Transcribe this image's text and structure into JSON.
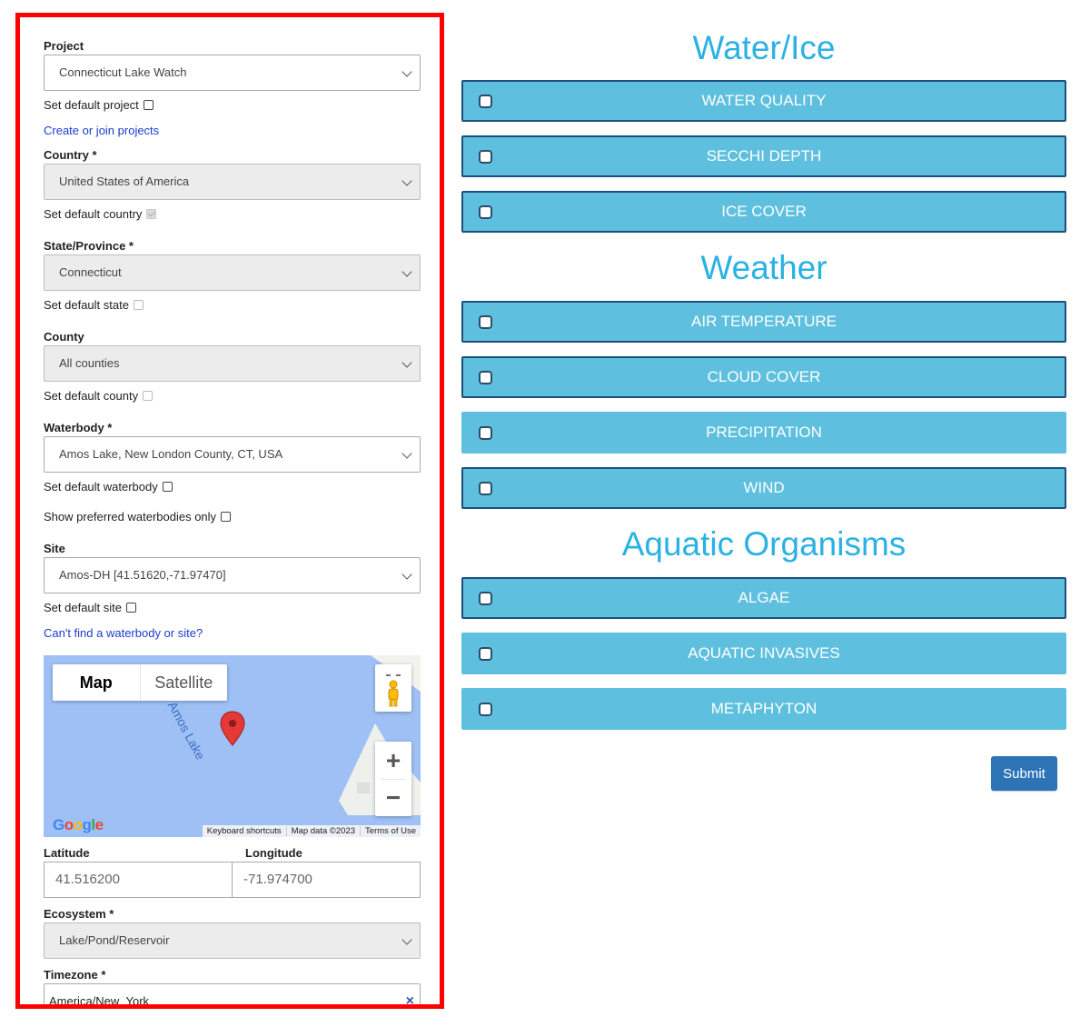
{
  "form": {
    "project": {
      "label": "Project",
      "value": "Connecticut Lake Watch",
      "default_label": "Set default project"
    },
    "create_link": "Create or join projects",
    "country": {
      "label": "Country *",
      "value": "United States of America",
      "default_label": "Set default country"
    },
    "state": {
      "label": "State/Province *",
      "value": "Connecticut",
      "default_label": "Set default state"
    },
    "county": {
      "label": "County",
      "value": "All counties",
      "default_label": "Set default county"
    },
    "waterbody": {
      "label": "Waterbody *",
      "value": "Amos Lake, New London County, CT, USA",
      "default_label": "Set default waterbody",
      "preferred_label": "Show preferred waterbodies only"
    },
    "site": {
      "label": "Site",
      "value": "Amos-DH [41.51620,-71.97470]",
      "default_label": "Set default site"
    },
    "cant_find_link": "Can't find a waterbody or site?",
    "map": {
      "type_map": "Map",
      "type_satellite": "Satellite",
      "zoom_in": "+",
      "zoom_out": "−",
      "logo": "Google",
      "lake_label": "Amos Lake",
      "attribution": [
        "Keyboard shortcuts",
        "Map data ©2023",
        "Terms of Use"
      ]
    },
    "latitude": {
      "label": "Latitude",
      "value": "41.516200"
    },
    "longitude": {
      "label": "Longitude",
      "value": "-71.974700"
    },
    "ecosystem": {
      "label": "Ecosystem *",
      "value": "Lake/Pond/Reservoir"
    },
    "timezone": {
      "label": "Timezone *",
      "value": "America/New_York",
      "clear": "×"
    }
  },
  "categories": {
    "water_ice": {
      "heading": "Water/Ice",
      "items": [
        "WATER QUALITY",
        "SECCHI DEPTH",
        "ICE COVER"
      ]
    },
    "weather": {
      "heading": "Weather",
      "items": [
        "AIR TEMPERATURE",
        "CLOUD COVER",
        "PRECIPITATION",
        "WIND"
      ]
    },
    "aquatic": {
      "heading": "Aquatic Organisms",
      "items": [
        "ALGAE",
        "AQUATIC INVASIVES",
        "METAPHYTON"
      ]
    }
  },
  "submit_label": "Submit",
  "colors": {
    "heading": "#2bb2e3",
    "category_bg": "#5ec0de",
    "category_border": "#1c4f7c",
    "submit_bg": "#2d74b6",
    "highlight": "#ff0000",
    "link": "#1a3dcc"
  }
}
